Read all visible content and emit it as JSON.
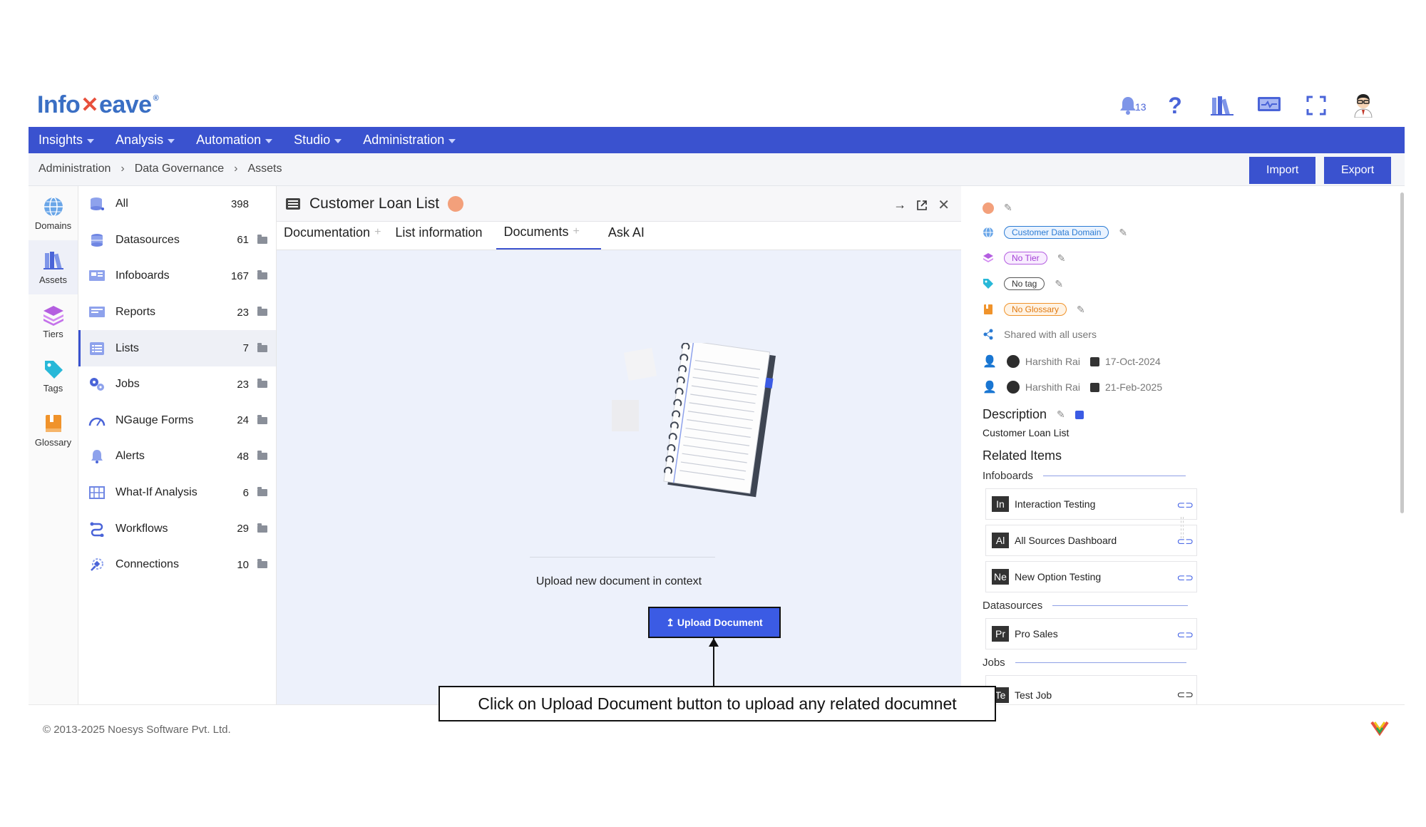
{
  "logo": {
    "pre": "Info",
    "post": "eave"
  },
  "header": {
    "notification_count": "13"
  },
  "nav": {
    "items": [
      {
        "label": "Insights"
      },
      {
        "label": "Analysis"
      },
      {
        "label": "Automation"
      },
      {
        "label": "Studio"
      },
      {
        "label": "Administration"
      }
    ]
  },
  "breadcrumb": [
    "Administration",
    "Data Governance",
    "Assets"
  ],
  "actions": {
    "import": "Import",
    "export": "Export"
  },
  "rail": [
    {
      "label": "Domains",
      "icon": "globe-icon"
    },
    {
      "label": "Assets",
      "icon": "books-icon"
    },
    {
      "label": "Tiers",
      "icon": "layers-icon"
    },
    {
      "label": "Tags",
      "icon": "tag-icon"
    },
    {
      "label": "Glossary",
      "icon": "book-icon"
    }
  ],
  "assets": [
    {
      "label": "All",
      "count": "398"
    },
    {
      "label": "Datasources",
      "count": "61"
    },
    {
      "label": "Infoboards",
      "count": "167"
    },
    {
      "label": "Reports",
      "count": "23"
    },
    {
      "label": "Lists",
      "count": "7"
    },
    {
      "label": "Jobs",
      "count": "23"
    },
    {
      "label": "NGauge Forms",
      "count": "24"
    },
    {
      "label": "Alerts",
      "count": "48"
    },
    {
      "label": "What-If Analysis",
      "count": "6"
    },
    {
      "label": "Workflows",
      "count": "29"
    },
    {
      "label": "Connections",
      "count": "10"
    }
  ],
  "main": {
    "title": "Customer Loan List",
    "tabs": [
      {
        "label": "Documentation",
        "plus": "+"
      },
      {
        "label": "List information",
        "plus": ""
      },
      {
        "label": "Documents",
        "plus": "+"
      },
      {
        "label": "Ask AI",
        "plus": ""
      }
    ],
    "empty_text": "Upload new document in context",
    "upload_label": "↥ Upload Document"
  },
  "callout": "Click on Upload Document button to upload any related documnet",
  "right": {
    "domain": "Customer Data Domain",
    "tier": "No Tier",
    "tag": "No tag",
    "glossary": "No Glossary",
    "shared": "Shared with all users",
    "created_by": "Harshith Rai",
    "created_on": "17-Oct-2024",
    "modified_by": "Harshith Rai",
    "modified_on": "21-Feb-2025",
    "description_title": "Description",
    "description_text": "Customer Loan List",
    "related_title": "Related Items",
    "groups": {
      "infoboards": "Infoboards",
      "datasources": "Datasources",
      "jobs": "Jobs"
    },
    "infoboards": [
      {
        "abbr": "In",
        "name": "Interaction Testing"
      },
      {
        "abbr": "Al",
        "name": "All Sources Dashboard"
      },
      {
        "abbr": "Ne",
        "name": "New Option Testing"
      }
    ],
    "datasources": [
      {
        "abbr": "Pr",
        "name": "Pro Sales"
      }
    ],
    "jobs": [
      {
        "abbr": "Te",
        "name": "Test Job"
      }
    ]
  },
  "footer": {
    "copyright": "© 2013-2025 Noesys Software Pvt. Ltd."
  },
  "colors": {
    "primary": "#3a52cf",
    "accent_button": "#3b5be4",
    "main_bg": "#edf1fb"
  }
}
